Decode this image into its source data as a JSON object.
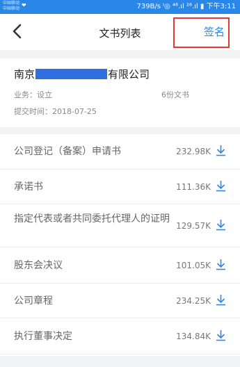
{
  "status_bar": {
    "carrier_line1": "中国移动",
    "carrier_line2": "中国移动",
    "right_text": "739B/s ᑊ◎ ⁴⁶.ıl ²⁶.ıl ▮ 下午3:11"
  },
  "nav": {
    "title": "文书列表",
    "sign_label": "签名"
  },
  "company": {
    "name_prefix": "南京",
    "name_suffix": "有限公司",
    "business": "业务：设立",
    "doc_count": "6份文书",
    "submit_time": "提交时间：2018-07-25"
  },
  "documents": [
    {
      "name": "公司登记（备案）申请书",
      "size": "232.98K"
    },
    {
      "name": "承诺书",
      "size": "111.36K"
    },
    {
      "name": "指定代表或者共同委托代理人的证明",
      "size": "129.57K"
    },
    {
      "name": "股东会决议",
      "size": "101.05K"
    },
    {
      "name": "公司章程",
      "size": "234.25K"
    },
    {
      "name": "执行董事决定",
      "size": "134.84K"
    }
  ],
  "colors": {
    "accent": "#2a87e8",
    "highlight_box": "#e53935",
    "redaction": "#2f6fe0"
  }
}
